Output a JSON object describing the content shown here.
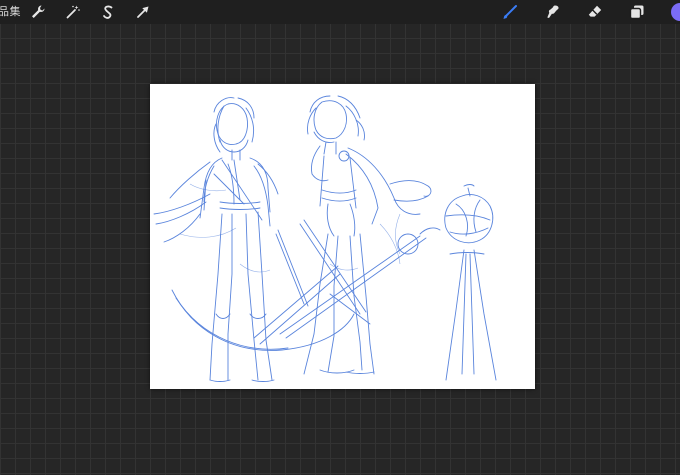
{
  "toolbar": {
    "gallery_label": "品集",
    "left_tools": [
      {
        "name": "actions-wrench-icon"
      },
      {
        "name": "adjustments-wand-icon"
      },
      {
        "name": "selection-s-icon"
      },
      {
        "name": "transform-arrow-icon"
      }
    ],
    "right_tools": [
      {
        "name": "brush-icon",
        "active": true
      },
      {
        "name": "smudge-icon"
      },
      {
        "name": "eraser-icon"
      },
      {
        "name": "layers-icon"
      }
    ],
    "current_color": "#7b6cf6",
    "active_color": "#3a7cf5",
    "icon_color": "#e6e6e6"
  },
  "canvas": {
    "background": "#ffffff",
    "sketch_color": "#3d6fd6"
  }
}
